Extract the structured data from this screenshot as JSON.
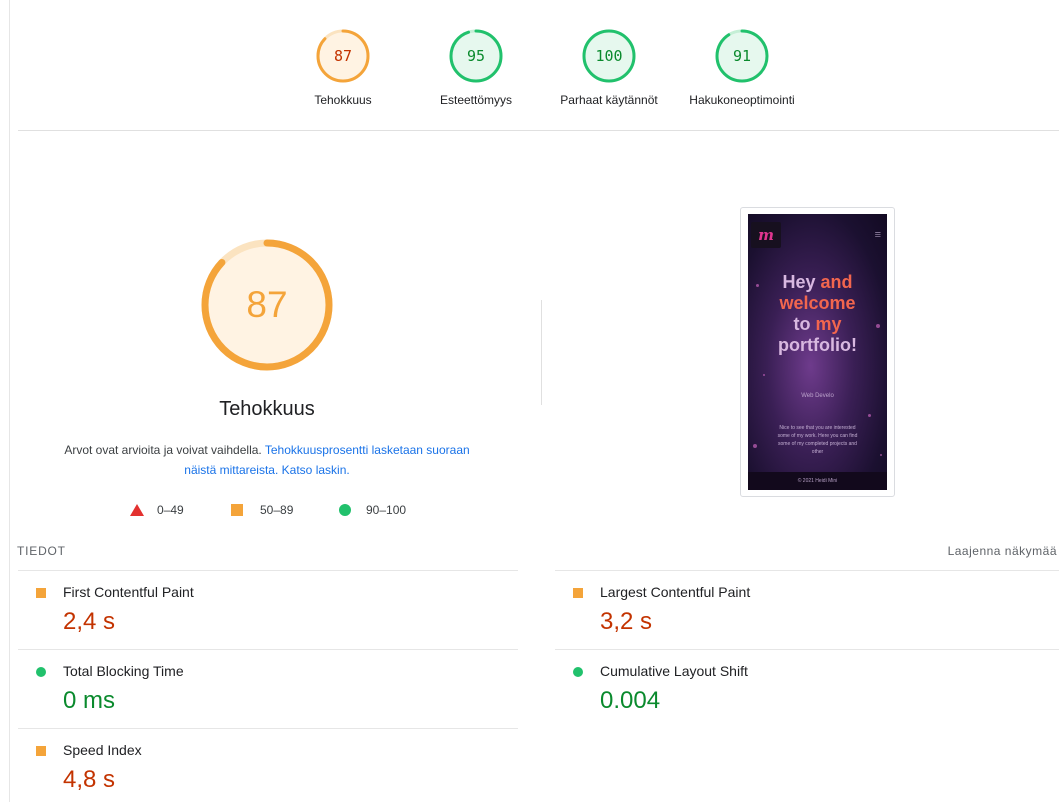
{
  "summary_gauges": [
    {
      "score": "87",
      "label": "Tehokkuus",
      "color": "#f4a43a",
      "fraction": 0.87
    },
    {
      "score": "95",
      "label": "Esteettömyys",
      "color": "#21c16c",
      "fraction": 0.95
    },
    {
      "score": "100",
      "label": "Parhaat käytännöt",
      "color": "#21c16c",
      "fraction": 1.0
    },
    {
      "score": "91",
      "label": "Hakukoneoptimointi",
      "color": "#21c16c",
      "fraction": 0.91
    }
  ],
  "performance": {
    "score": "87",
    "fraction": 0.87,
    "title": "Tehokkuus",
    "desc_text_1": "Arvot ovat arvioita ja voivat vaihdella. ",
    "desc_link_1": "Tehokkuusprosentti lasketaan suoraan näistä mittareista.",
    "desc_space": " ",
    "desc_link_2": "Katso laskin.",
    "legend": {
      "fail": "0–49",
      "average": "50–89",
      "pass": "90–100"
    }
  },
  "screenshot": {
    "logo_text": "m",
    "heading_line_1a": "Hey ",
    "heading_line_1b": "and",
    "heading_line_2": "welcome",
    "heading_line_3a": "to ",
    "heading_line_3b": "my",
    "heading_line_4": "portfolio!",
    "subtitle": "Web Develo",
    "body": "Nice to see that you are interested some of my work. Here you can find some of my completed projects and other",
    "footer": "© 2021 Heidi Mini"
  },
  "metrics_section": {
    "title": "TIEDOT",
    "expand_label": "Laajenna näkymää"
  },
  "metrics": [
    {
      "name": "First Contentful Paint",
      "value": "2,4 s",
      "status": "average"
    },
    {
      "name": "Largest Contentful Paint",
      "value": "3,2 s",
      "status": "average"
    },
    {
      "name": "Total Blocking Time",
      "value": "0 ms",
      "status": "pass"
    },
    {
      "name": "Cumulative Layout Shift",
      "value": "0.004",
      "status": "pass"
    },
    {
      "name": "Speed Index",
      "value": "4,8 s",
      "status": "average"
    }
  ],
  "colors": {
    "average": "#f4a43a",
    "pass": "#21c16c",
    "fail": "#e3312f",
    "average_text": "#c33300",
    "pass_text": "#0a8a2d",
    "link": "#1a73e8"
  }
}
